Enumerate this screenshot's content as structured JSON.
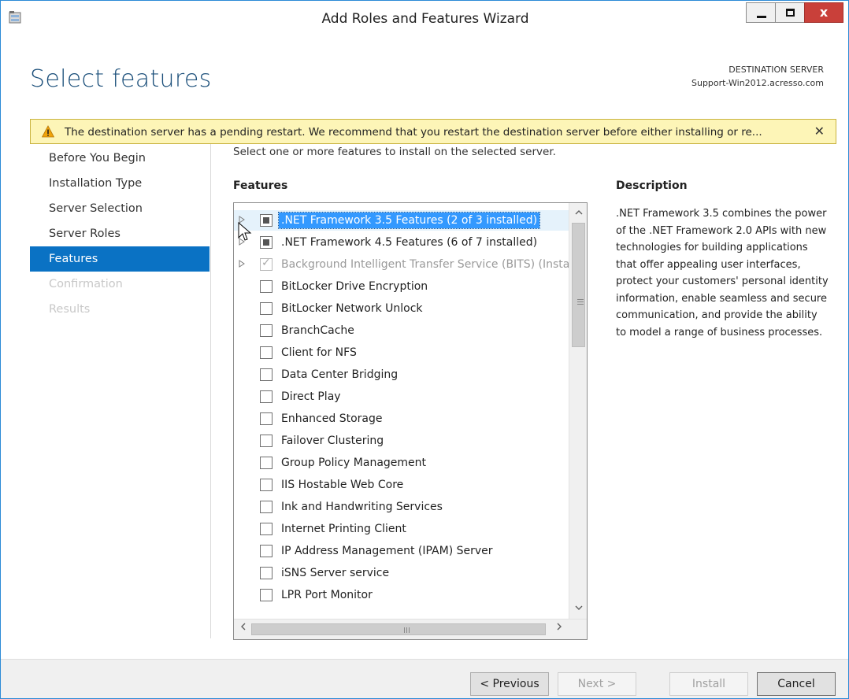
{
  "window": {
    "title": "Add Roles and Features Wizard",
    "controls": {
      "minimize": "minimize",
      "maximize": "maximize",
      "close": "x"
    }
  },
  "header": {
    "page_title": "Select features",
    "destination_label": "DESTINATION SERVER",
    "destination_server": "Support-Win2012.acresso.com"
  },
  "warning": {
    "text": "The destination server has a pending restart. We recommend that you restart the destination server before either installing or re...",
    "close": "✕"
  },
  "nav": {
    "items": [
      {
        "label": "Before You Begin",
        "state": "normal"
      },
      {
        "label": "Installation Type",
        "state": "normal"
      },
      {
        "label": "Server Selection",
        "state": "normal"
      },
      {
        "label": "Server Roles",
        "state": "normal"
      },
      {
        "label": "Features",
        "state": "active"
      },
      {
        "label": "Confirmation",
        "state": "disabled"
      },
      {
        "label": "Results",
        "state": "disabled"
      }
    ]
  },
  "main": {
    "instruction": "Select one or more features to install on the selected server.",
    "features_heading": "Features",
    "features": [
      {
        "label": ".NET Framework 3.5 Features (2 of 3 installed)",
        "expander": true,
        "checkbox": "partial",
        "selected": true,
        "disabled": false
      },
      {
        "label": ".NET Framework 4.5 Features (6 of 7 installed)",
        "expander": true,
        "checkbox": "partial",
        "selected": false,
        "disabled": false
      },
      {
        "label": "Background Intelligent Transfer Service (BITS) (Install",
        "expander": true,
        "checkbox": "checked",
        "selected": false,
        "disabled": true
      },
      {
        "label": "BitLocker Drive Encryption",
        "expander": false,
        "checkbox": "unchecked",
        "selected": false,
        "disabled": false
      },
      {
        "label": "BitLocker Network Unlock",
        "expander": false,
        "checkbox": "unchecked",
        "selected": false,
        "disabled": false
      },
      {
        "label": "BranchCache",
        "expander": false,
        "checkbox": "unchecked",
        "selected": false,
        "disabled": false
      },
      {
        "label": "Client for NFS",
        "expander": false,
        "checkbox": "unchecked",
        "selected": false,
        "disabled": false
      },
      {
        "label": "Data Center Bridging",
        "expander": false,
        "checkbox": "unchecked",
        "selected": false,
        "disabled": false
      },
      {
        "label": "Direct Play",
        "expander": false,
        "checkbox": "unchecked",
        "selected": false,
        "disabled": false
      },
      {
        "label": "Enhanced Storage",
        "expander": false,
        "checkbox": "unchecked",
        "selected": false,
        "disabled": false
      },
      {
        "label": "Failover Clustering",
        "expander": false,
        "checkbox": "unchecked",
        "selected": false,
        "disabled": false
      },
      {
        "label": "Group Policy Management",
        "expander": false,
        "checkbox": "unchecked",
        "selected": false,
        "disabled": false
      },
      {
        "label": "IIS Hostable Web Core",
        "expander": false,
        "checkbox": "unchecked",
        "selected": false,
        "disabled": false
      },
      {
        "label": "Ink and Handwriting Services",
        "expander": false,
        "checkbox": "unchecked",
        "selected": false,
        "disabled": false
      },
      {
        "label": "Internet Printing Client",
        "expander": false,
        "checkbox": "unchecked",
        "selected": false,
        "disabled": false
      },
      {
        "label": "IP Address Management (IPAM) Server",
        "expander": false,
        "checkbox": "unchecked",
        "selected": false,
        "disabled": false
      },
      {
        "label": "iSNS Server service",
        "expander": false,
        "checkbox": "unchecked",
        "selected": false,
        "disabled": false
      },
      {
        "label": "LPR Port Monitor",
        "expander": false,
        "checkbox": "unchecked",
        "selected": false,
        "disabled": false
      }
    ],
    "vscroll": {
      "up": "^",
      "down": "v"
    },
    "hscroll": {
      "left": "<",
      "right": ">"
    }
  },
  "description": {
    "heading": "Description",
    "text": ".NET Framework 3.5 combines the power of the .NET Framework 2.0 APIs with new technologies for building applications that offer appealing user interfaces, protect your customers' personal identity information, enable seamless and secure communication, and provide the ability to model a range of business processes."
  },
  "footer": {
    "previous": "< Previous",
    "next": "Next >",
    "install": "Install",
    "cancel": "Cancel"
  },
  "colors": {
    "accent": "#0a72c4",
    "selection": "#3399ff",
    "title_text": "#1b4f7a",
    "warning_bg": "#fdf5b7",
    "close_button": "#c9403a"
  }
}
